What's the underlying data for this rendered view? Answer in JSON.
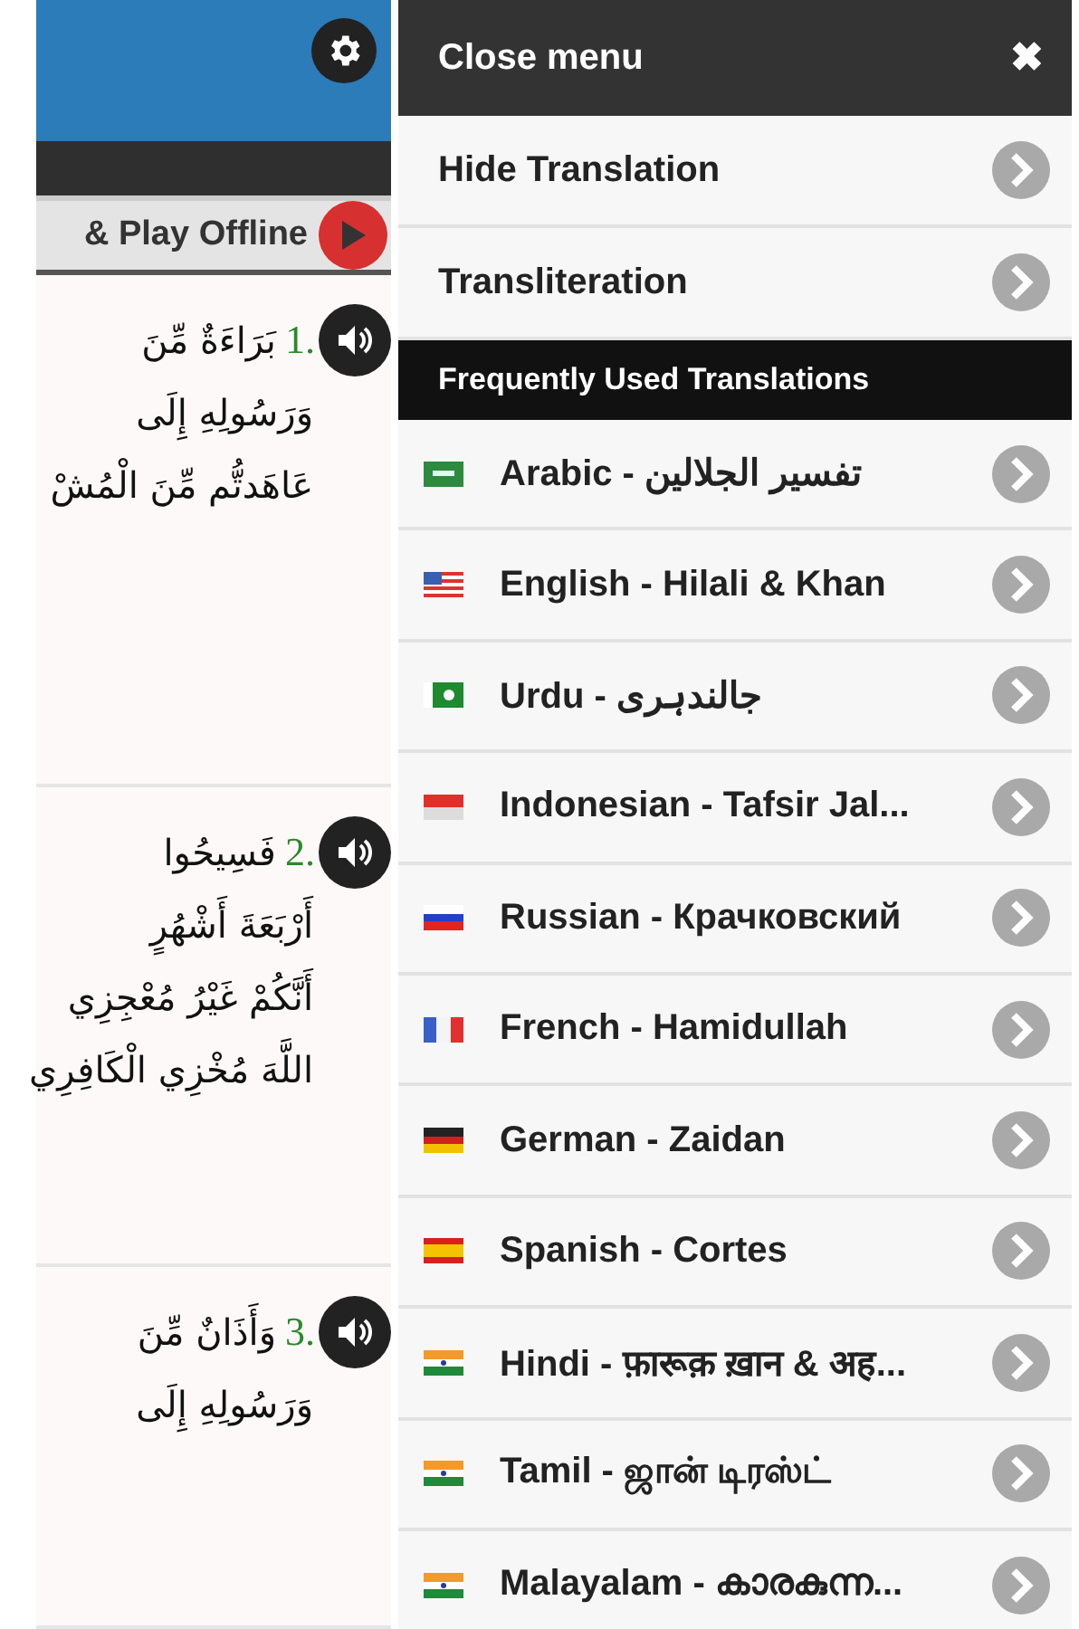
{
  "left_panel": {
    "offline_bar": {
      "label": "& Play Offline"
    },
    "verses": [
      {
        "number": "1.",
        "lines": [
          "بَرَاءَةٌ مِّنَ",
          "وَرَسُولِهِ إِلَى",
          "عَاهَدتُّم مِّنَ الْمُشْ"
        ]
      },
      {
        "number": "2.",
        "lines": [
          "فَسِيحُوا",
          "أَرْبَعَةَ أَشْهُرٍ",
          "أَنَّكُمْ غَيْرُ مُعْجِزِي",
          "اللَّهَ مُخْزِي الْكَافِرِي"
        ]
      },
      {
        "number": "3.",
        "lines": [
          "وَأَذَانٌ مِّنَ",
          "وَرَسُولِهِ إِلَى"
        ]
      }
    ]
  },
  "menu": {
    "close": {
      "label": "Close menu",
      "symbol": "✖"
    },
    "options": [
      {
        "label": "Hide Translation"
      },
      {
        "label": "Transliteration"
      }
    ],
    "section_title": "Frequently Used Translations",
    "translations": [
      {
        "label": "Arabic - تفسير الجلالين"
      },
      {
        "label": "English - Hilali & Khan"
      },
      {
        "label": "Urdu - جالندہری"
      },
      {
        "label": "Indonesian - Tafsir Jal..."
      },
      {
        "label": "Russian - Крачковский"
      },
      {
        "label": "French - Hamidullah"
      },
      {
        "label": "German - Zaidan"
      },
      {
        "label": "Spanish - Cortes"
      },
      {
        "label": "Hindi - फ़ारूक़ ख़ान & अह..."
      },
      {
        "label": "Tamil - ஜான் டிரஸ்ட்"
      },
      {
        "label": "Malayalam - കാരകുന്ന..."
      }
    ]
  }
}
